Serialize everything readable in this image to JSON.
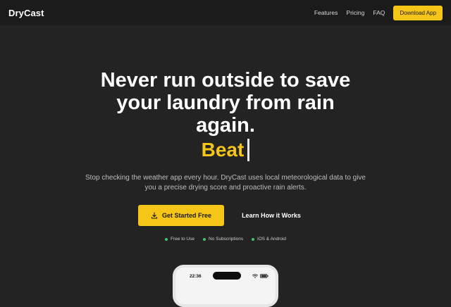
{
  "nav": {
    "logo": "DryCast",
    "links": [
      "Features",
      "Pricing",
      "FAQ"
    ],
    "cta": "Download App"
  },
  "hero": {
    "title": "Never run outside to save your laundry from rain again.",
    "typed_word": "Beat",
    "subtitle": "Stop checking the weather app every hour. DryCast uses local meteorological data to give you a precise drying score and proactive rain alerts.",
    "primary_cta": "Get Started Free",
    "secondary_cta": "Learn How it Works",
    "features": [
      "Free to Use",
      "No Subscriptions",
      "iOS & Android"
    ]
  },
  "phone": {
    "time": "22:36"
  },
  "colors": {
    "accent": "#f5c518",
    "background": "#232323",
    "nav_background": "#1b1b1b",
    "feature_dot": "#3ec46d"
  },
  "icons": {
    "primary_cta": "download-icon",
    "phone_status": [
      "wifi-icon",
      "battery-icon"
    ]
  }
}
